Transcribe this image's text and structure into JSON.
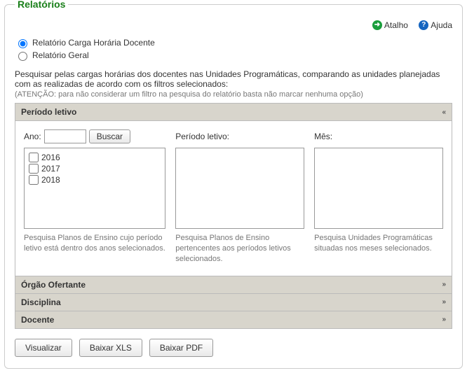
{
  "title": "Relatórios",
  "toplinks": {
    "atalho": "Atalho",
    "ajuda": "Ajuda"
  },
  "radios": {
    "carga": "Relatório Carga Horária Docente",
    "geral": "Relatório Geral"
  },
  "description": "Pesquisar pelas cargas horárias dos docentes nas Unidades Programáticas, comparando as unidades planejadas com as realizadas de acordo com os filtros selecionados:",
  "note": "(ATENÇÃO: para não considerar um filtro na pesquisa do relatório basta não marcar nenhuma opção)",
  "sections": {
    "periodo": {
      "header": "Período letivo",
      "ano_label": "Ano:",
      "ano_value": "",
      "buscar": "Buscar",
      "years": [
        "2016",
        "2017",
        "2018"
      ],
      "hint_ano": "Pesquisa Planos de Ensino cujo período letivo está dentro dos anos selecionados.",
      "periodo_label": "Período letivo:",
      "hint_periodo": "Pesquisa Planos de Ensino pertencentes aos períodos letivos selecionados.",
      "mes_label": "Mês:",
      "hint_mes": "Pesquisa Unidades Programáticas situadas nos meses selecionados."
    },
    "orgao": "Órgão Ofertante",
    "disciplina": "Disciplina",
    "docente": "Docente"
  },
  "buttons": {
    "visualizar": "Visualizar",
    "xls": "Baixar XLS",
    "pdf": "Baixar PDF"
  },
  "glyphs": {
    "collapse": "«",
    "expand": "»",
    "arrow": "➜",
    "question": "?"
  }
}
